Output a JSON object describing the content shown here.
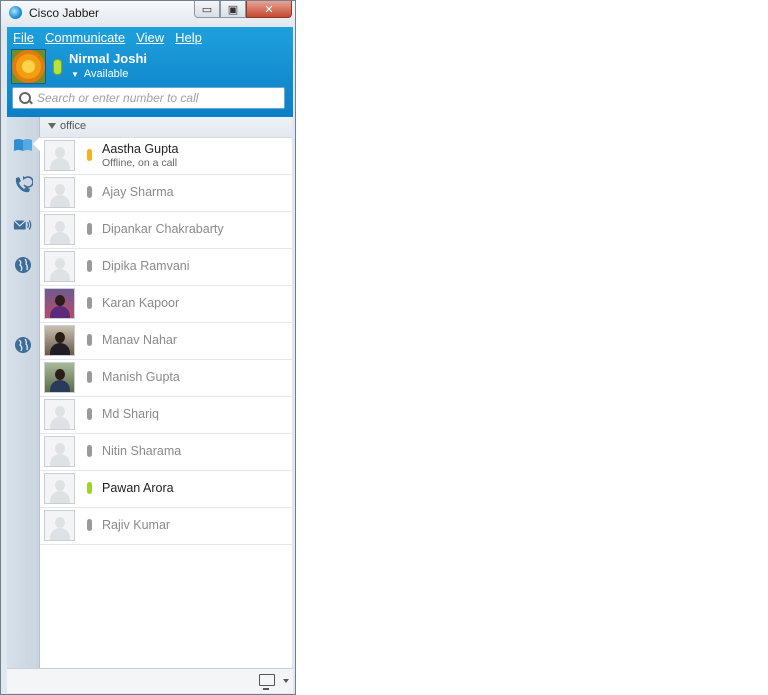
{
  "window": {
    "title": "Cisco Jabber",
    "buttons": {
      "minimize": "▭",
      "maximize": "▣",
      "close": "✕"
    }
  },
  "menu": {
    "items": [
      "File",
      "Communicate",
      "View",
      "Help"
    ]
  },
  "me": {
    "name": "Nirmal Joshi",
    "status": "Available",
    "status_color": "#b6e43d"
  },
  "search": {
    "placeholder": "Search or enter number to call"
  },
  "rail": {
    "icons": [
      "contacts-book-icon",
      "recent-calls-icon",
      "voicemail-icon",
      "globe-icon",
      "globe-icon-2"
    ]
  },
  "group": {
    "name": "office"
  },
  "contacts": [
    {
      "name": "Aastha Gupta",
      "status": "away",
      "note": "Offline, on a call",
      "avatar": "default"
    },
    {
      "name": "Ajay Sharma",
      "status": "offline",
      "note": "",
      "avatar": "default"
    },
    {
      "name": "Dipankar Chakrabarty",
      "status": "offline",
      "note": "",
      "avatar": "default"
    },
    {
      "name": "Dipika Ramvani",
      "status": "offline",
      "note": "",
      "avatar": "default"
    },
    {
      "name": "Karan Kapoor",
      "status": "offline",
      "note": "",
      "avatar": "photo1"
    },
    {
      "name": "Manav Nahar",
      "status": "offline",
      "note": "",
      "avatar": "photo2"
    },
    {
      "name": "Manish Gupta",
      "status": "offline",
      "note": "",
      "avatar": "photo3"
    },
    {
      "name": "Md Shariq",
      "status": "offline",
      "note": "",
      "avatar": "default"
    },
    {
      "name": "Nitin Sharama",
      "status": "offline",
      "note": "",
      "avatar": "default"
    },
    {
      "name": "Pawan Arora",
      "status": "available",
      "note": "",
      "avatar": "default"
    },
    {
      "name": "Rajiv Kumar",
      "status": "offline",
      "note": "",
      "avatar": "default"
    }
  ],
  "colors": {
    "header": "#1ea0dc",
    "away": "#f2b21c",
    "available": "#9fd32a",
    "offline": "#9a9a9a"
  }
}
